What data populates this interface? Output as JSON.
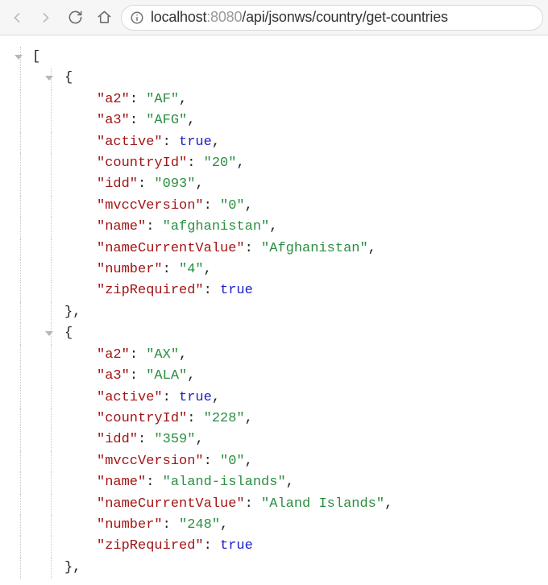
{
  "toolbar": {
    "url_prefix": "localhost",
    "url_port": ":8080",
    "url_path": "/api/jsonws/country/get-countries"
  },
  "json": {
    "open_bracket": "[",
    "open_brace": "{",
    "close_brace_comma": "},",
    "comma": ",",
    "colon_sp": ": ",
    "items": [
      {
        "pairs": [
          {
            "k": "\"a2\"",
            "v": "\"AF\"",
            "t": "str"
          },
          {
            "k": "\"a3\"",
            "v": "\"AFG\"",
            "t": "str"
          },
          {
            "k": "\"active\"",
            "v": "true",
            "t": "bool"
          },
          {
            "k": "\"countryId\"",
            "v": "\"20\"",
            "t": "str"
          },
          {
            "k": "\"idd\"",
            "v": "\"093\"",
            "t": "str"
          },
          {
            "k": "\"mvccVersion\"",
            "v": "\"0\"",
            "t": "str"
          },
          {
            "k": "\"name\"",
            "v": "\"afghanistan\"",
            "t": "str"
          },
          {
            "k": "\"nameCurrentValue\"",
            "v": "\"Afghanistan\"",
            "t": "str"
          },
          {
            "k": "\"number\"",
            "v": "\"4\"",
            "t": "str"
          },
          {
            "k": "\"zipRequired\"",
            "v": "true",
            "t": "bool"
          }
        ]
      },
      {
        "pairs": [
          {
            "k": "\"a2\"",
            "v": "\"AX\"",
            "t": "str"
          },
          {
            "k": "\"a3\"",
            "v": "\"ALA\"",
            "t": "str"
          },
          {
            "k": "\"active\"",
            "v": "true",
            "t": "bool"
          },
          {
            "k": "\"countryId\"",
            "v": "\"228\"",
            "t": "str"
          },
          {
            "k": "\"idd\"",
            "v": "\"359\"",
            "t": "str"
          },
          {
            "k": "\"mvccVersion\"",
            "v": "\"0\"",
            "t": "str"
          },
          {
            "k": "\"name\"",
            "v": "\"aland-islands\"",
            "t": "str"
          },
          {
            "k": "\"nameCurrentValue\"",
            "v": "\"Aland Islands\"",
            "t": "str"
          },
          {
            "k": "\"number\"",
            "v": "\"248\"",
            "t": "str"
          },
          {
            "k": "\"zipRequired\"",
            "v": "true",
            "t": "bool"
          }
        ]
      }
    ]
  }
}
